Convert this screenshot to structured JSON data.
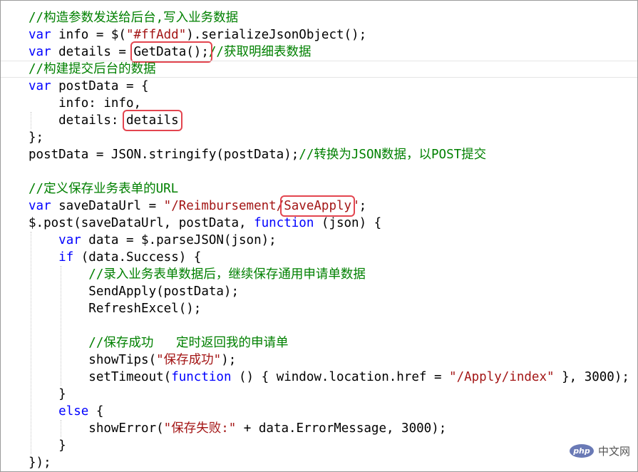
{
  "code": {
    "l1": {
      "comment": "//构造参数发送给后台,写入业务数据"
    },
    "l2": {
      "kw": "var",
      "a": " info = $(",
      "str": "\"#ffAdd\"",
      "b": ").serializeJsonObject();"
    },
    "l3": {
      "kw": "var",
      "a": " details = ",
      "hl": "GetData();",
      "comment": "//获取明细表数据"
    },
    "l4": {
      "comment": "//构建提交后台的数据"
    },
    "l5": {
      "kw": "var",
      "a": " postData = {"
    },
    "l6": {
      "a": "    info: info,"
    },
    "l7": {
      "a": "    details: ",
      "hl": "details"
    },
    "l8": {
      "a": "};"
    },
    "l9": {
      "a": "postData = JSON.stringify(postData);",
      "comment": "//转换为JSON数据，以POST提交"
    },
    "l11": {
      "comment": "//定义保存业务表单的URL"
    },
    "l12": {
      "kw": "var",
      "a": " saveDataUrl = ",
      "str1": "\"/Reimbursement/",
      "hl": "SaveApply",
      "str2": "\"",
      "b": ";"
    },
    "l13": {
      "a": "$.post(saveDataUrl, postData, ",
      "kw": "function",
      "b": " (json) {"
    },
    "l14": {
      "indent": "    ",
      "kw": "var",
      "a": " data = $.parseJSON(json);"
    },
    "l15": {
      "indent": "    ",
      "kw": "if",
      "a": " (data.Success) {"
    },
    "l16": {
      "indent": "        ",
      "comment": "//录入业务表单数据后，继续保存通用申请单数据"
    },
    "l17": {
      "a": "        SendApply(postData);"
    },
    "l18": {
      "a": "        RefreshExcel();"
    },
    "l20": {
      "indent": "        ",
      "comment": "//保存成功   定时返回我的申请单"
    },
    "l21": {
      "a": "        showTips(",
      "str": "\"保存成功\"",
      "b": ");"
    },
    "l22": {
      "a": "        setTimeout(",
      "kw": "function",
      "b": " () { window.location.href = ",
      "str": "\"/Apply/index\"",
      "c": " }, 3000);"
    },
    "l23": {
      "a": "    }"
    },
    "l24": {
      "indent": "    ",
      "kw": "else",
      "a": " {"
    },
    "l25": {
      "a": "        showError(",
      "str": "\"保存失败:\"",
      "b": " + data.ErrorMessage, 3000);"
    },
    "l26": {
      "a": "    }"
    },
    "l27": {
      "a": "});"
    }
  },
  "watermark": {
    "logo": "php",
    "text": "中文网"
  }
}
